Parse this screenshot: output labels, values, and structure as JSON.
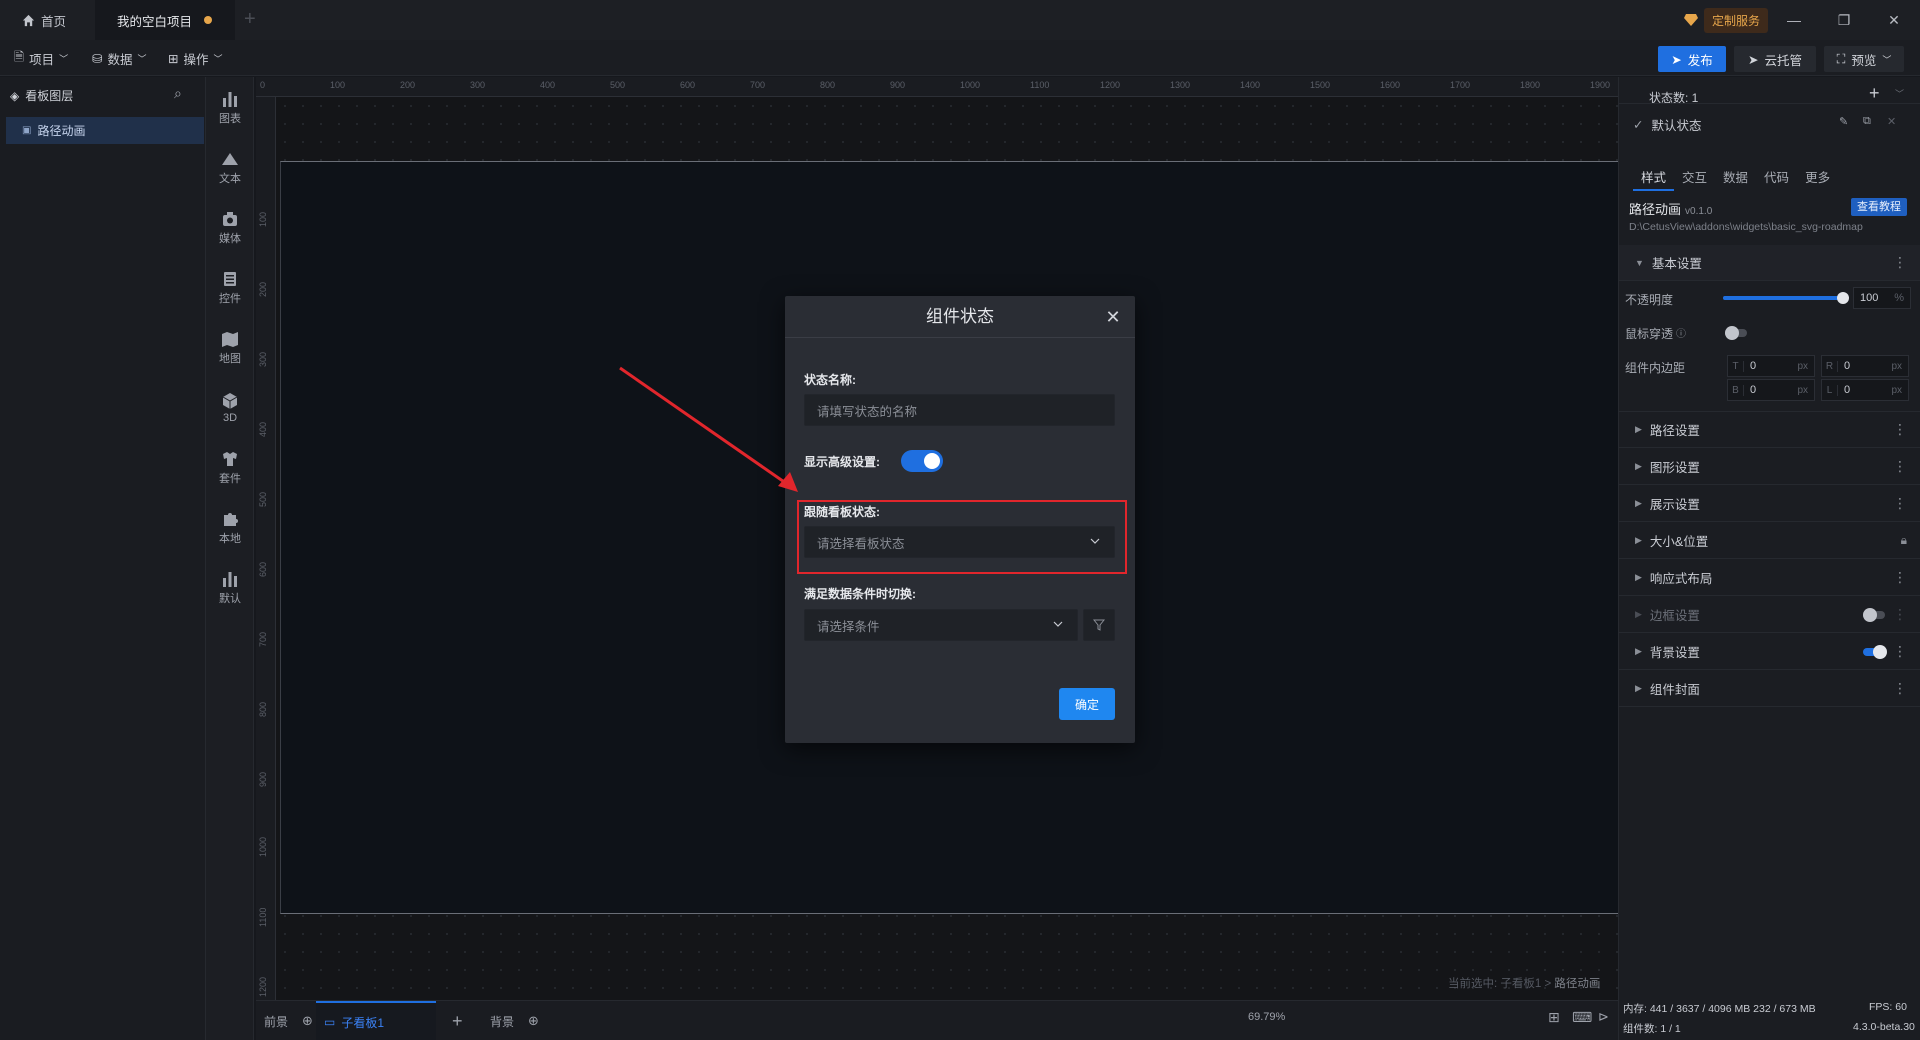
{
  "titlebar": {
    "home_tab": "首页",
    "project_tab": "我的空白项目",
    "custom_service": "定制服务"
  },
  "menubar": {
    "project": "项目",
    "data": "数据",
    "operate": "操作",
    "publish": "发布",
    "cloud": "云托管",
    "preview": "预览"
  },
  "layers": {
    "title": "看板图层",
    "items": [
      {
        "label": "路径动画"
      }
    ]
  },
  "toolbox": [
    {
      "label": "图表",
      "icon": "chart-icon"
    },
    {
      "label": "文本",
      "icon": "text-icon"
    },
    {
      "label": "媒体",
      "icon": "media-icon"
    },
    {
      "label": "控件",
      "icon": "control-icon"
    },
    {
      "label": "地图",
      "icon": "map-icon"
    },
    {
      "label": "3D",
      "icon": "cube-icon"
    },
    {
      "label": "套件",
      "icon": "suite-icon"
    },
    {
      "label": "本地",
      "icon": "puzzle-icon"
    },
    {
      "label": "默认",
      "icon": "default-chart-icon"
    }
  ],
  "ruler": {
    "top": [
      "0",
      "100",
      "200",
      "300",
      "400",
      "500",
      "600",
      "700",
      "800",
      "900",
      "1000",
      "1100",
      "1200",
      "1300",
      "1400",
      "1500",
      "1600",
      "1700",
      "1800",
      "1900"
    ],
    "left": [
      "100",
      "200",
      "300",
      "400",
      "500",
      "600",
      "700",
      "800",
      "900",
      "1000",
      "1100",
      "1200"
    ]
  },
  "canvas": {
    "breadcrumb_prefix": "当前选中: 子看板1 > ",
    "breadcrumb_current": "路径动画"
  },
  "bottombar": {
    "front": "前景",
    "child": "子看板1",
    "background": "背景",
    "zoom": "69.79%"
  },
  "status": {
    "memory": "内存: 441 / 3637 / 4096 MB  232 / 673 MB",
    "fps": "FPS: 60",
    "count": "组件数: 1 / 1",
    "version": "4.3.0-beta.30"
  },
  "rpanel": {
    "state_count": "状态数: 1",
    "default_state": "默认状态",
    "tabs": [
      "样式",
      "交互",
      "数据",
      "代码",
      "更多"
    ],
    "component_name": "路径动画",
    "component_version": "v0.1.0",
    "tutorial": "查看教程",
    "path": "D:\\CetusView\\addons\\widgets\\basic_svg-roadmap",
    "basic_settings": "基本设置",
    "opacity_label": "不透明度",
    "opacity_value": "100",
    "opacity_unit": "%",
    "opacity_level": 1.0,
    "mouse_through": "鼠标穿透",
    "inner_padding": "组件内边距",
    "padding": [
      {
        "k": "T",
        "v": "0",
        "u": "px"
      },
      {
        "k": "R",
        "v": "0",
        "u": "px"
      },
      {
        "k": "B",
        "v": "0",
        "u": "px"
      },
      {
        "k": "L",
        "v": "0",
        "u": "px"
      }
    ],
    "sections": [
      "路径设置",
      "图形设置",
      "展示设置",
      "大小&位置",
      "响应式布局",
      "边框设置",
      "背景设置",
      "组件封面"
    ]
  },
  "modal": {
    "title": "组件状态",
    "state_name_label": "状态名称:",
    "state_name_placeholder": "请填写状态的名称",
    "show_advanced_label": "显示高级设置:",
    "follow_label": "跟随看板状态:",
    "follow_placeholder": "请选择看板状态",
    "condition_label": "满足数据条件时切换:",
    "condition_placeholder": "请选择条件",
    "ok": "确定"
  },
  "colors": {
    "accent": "#1f6fe0",
    "highlight": "#e1262c",
    "custom_service": "#e7a64b"
  }
}
